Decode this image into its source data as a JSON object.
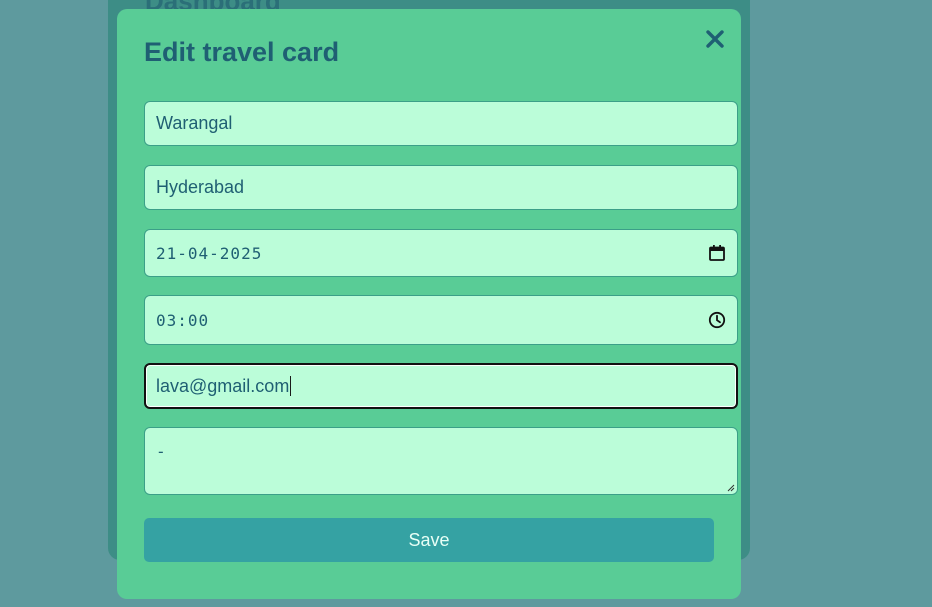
{
  "background": {
    "title": "Dashboard"
  },
  "modal": {
    "title": "Edit travel card",
    "close_icon": "close-icon",
    "fields": {
      "from": "Warangal",
      "to": "Hyderabad",
      "date": "21-04-2025",
      "time": "03:00",
      "email": "lava@gmail.com",
      "notes": "-"
    },
    "icons": {
      "date": "calendar-icon",
      "time": "clock-icon"
    },
    "save_label": "Save"
  },
  "colors": {
    "page_background": "#5e9a9e",
    "modal_background": "#59cc96",
    "field_background": "#bbfdd9",
    "text": "#1f5f73",
    "save_button": "#35a2a3"
  }
}
